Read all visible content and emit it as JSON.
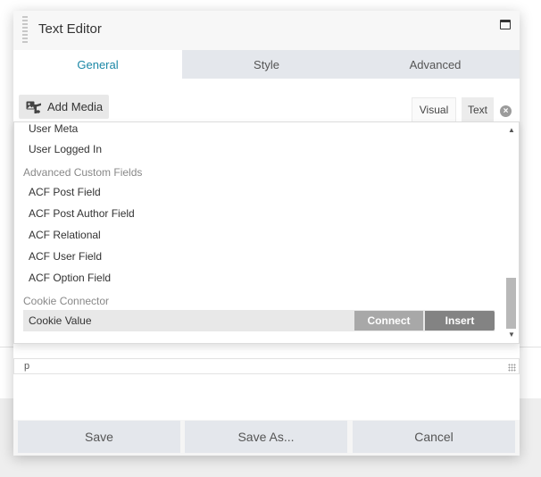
{
  "dialog": {
    "title": "Text Editor",
    "maximize_icon": "maximize-icon",
    "drag_icon": "drag-handle-icon"
  },
  "tabs": [
    {
      "label": "General",
      "active": true
    },
    {
      "label": "Style",
      "active": false
    },
    {
      "label": "Advanced",
      "active": false
    }
  ],
  "editor": {
    "add_media_label": "Add Media",
    "add_media_icon": "media-icon",
    "mode_visual": "Visual",
    "mode_text": "Text",
    "close_icon": "close-icon",
    "status_path": "p"
  },
  "dropdown": {
    "items": {
      "user_meta": "User Meta",
      "user_logged_in": "User Logged In",
      "group_acf": "Advanced Custom Fields",
      "acf_post_field": "ACF Post Field",
      "acf_post_author_field": "ACF Post Author Field",
      "acf_relational": "ACF Relational",
      "acf_user_field": "ACF User Field",
      "acf_option_field": "ACF Option Field",
      "group_cookie": "Cookie Connector",
      "cookie_value": "Cookie Value"
    },
    "connect_label": "Connect",
    "insert_label": "Insert",
    "scroll_position": 0.78
  },
  "footer": {
    "save_label": "Save",
    "save_as_label": "Save As...",
    "cancel_label": "Cancel"
  },
  "colors": {
    "accent": "#1b87a6",
    "tab_bar": "#e4e7ec",
    "insert_button": "#838383",
    "connect_button": "#a8a8a8"
  }
}
